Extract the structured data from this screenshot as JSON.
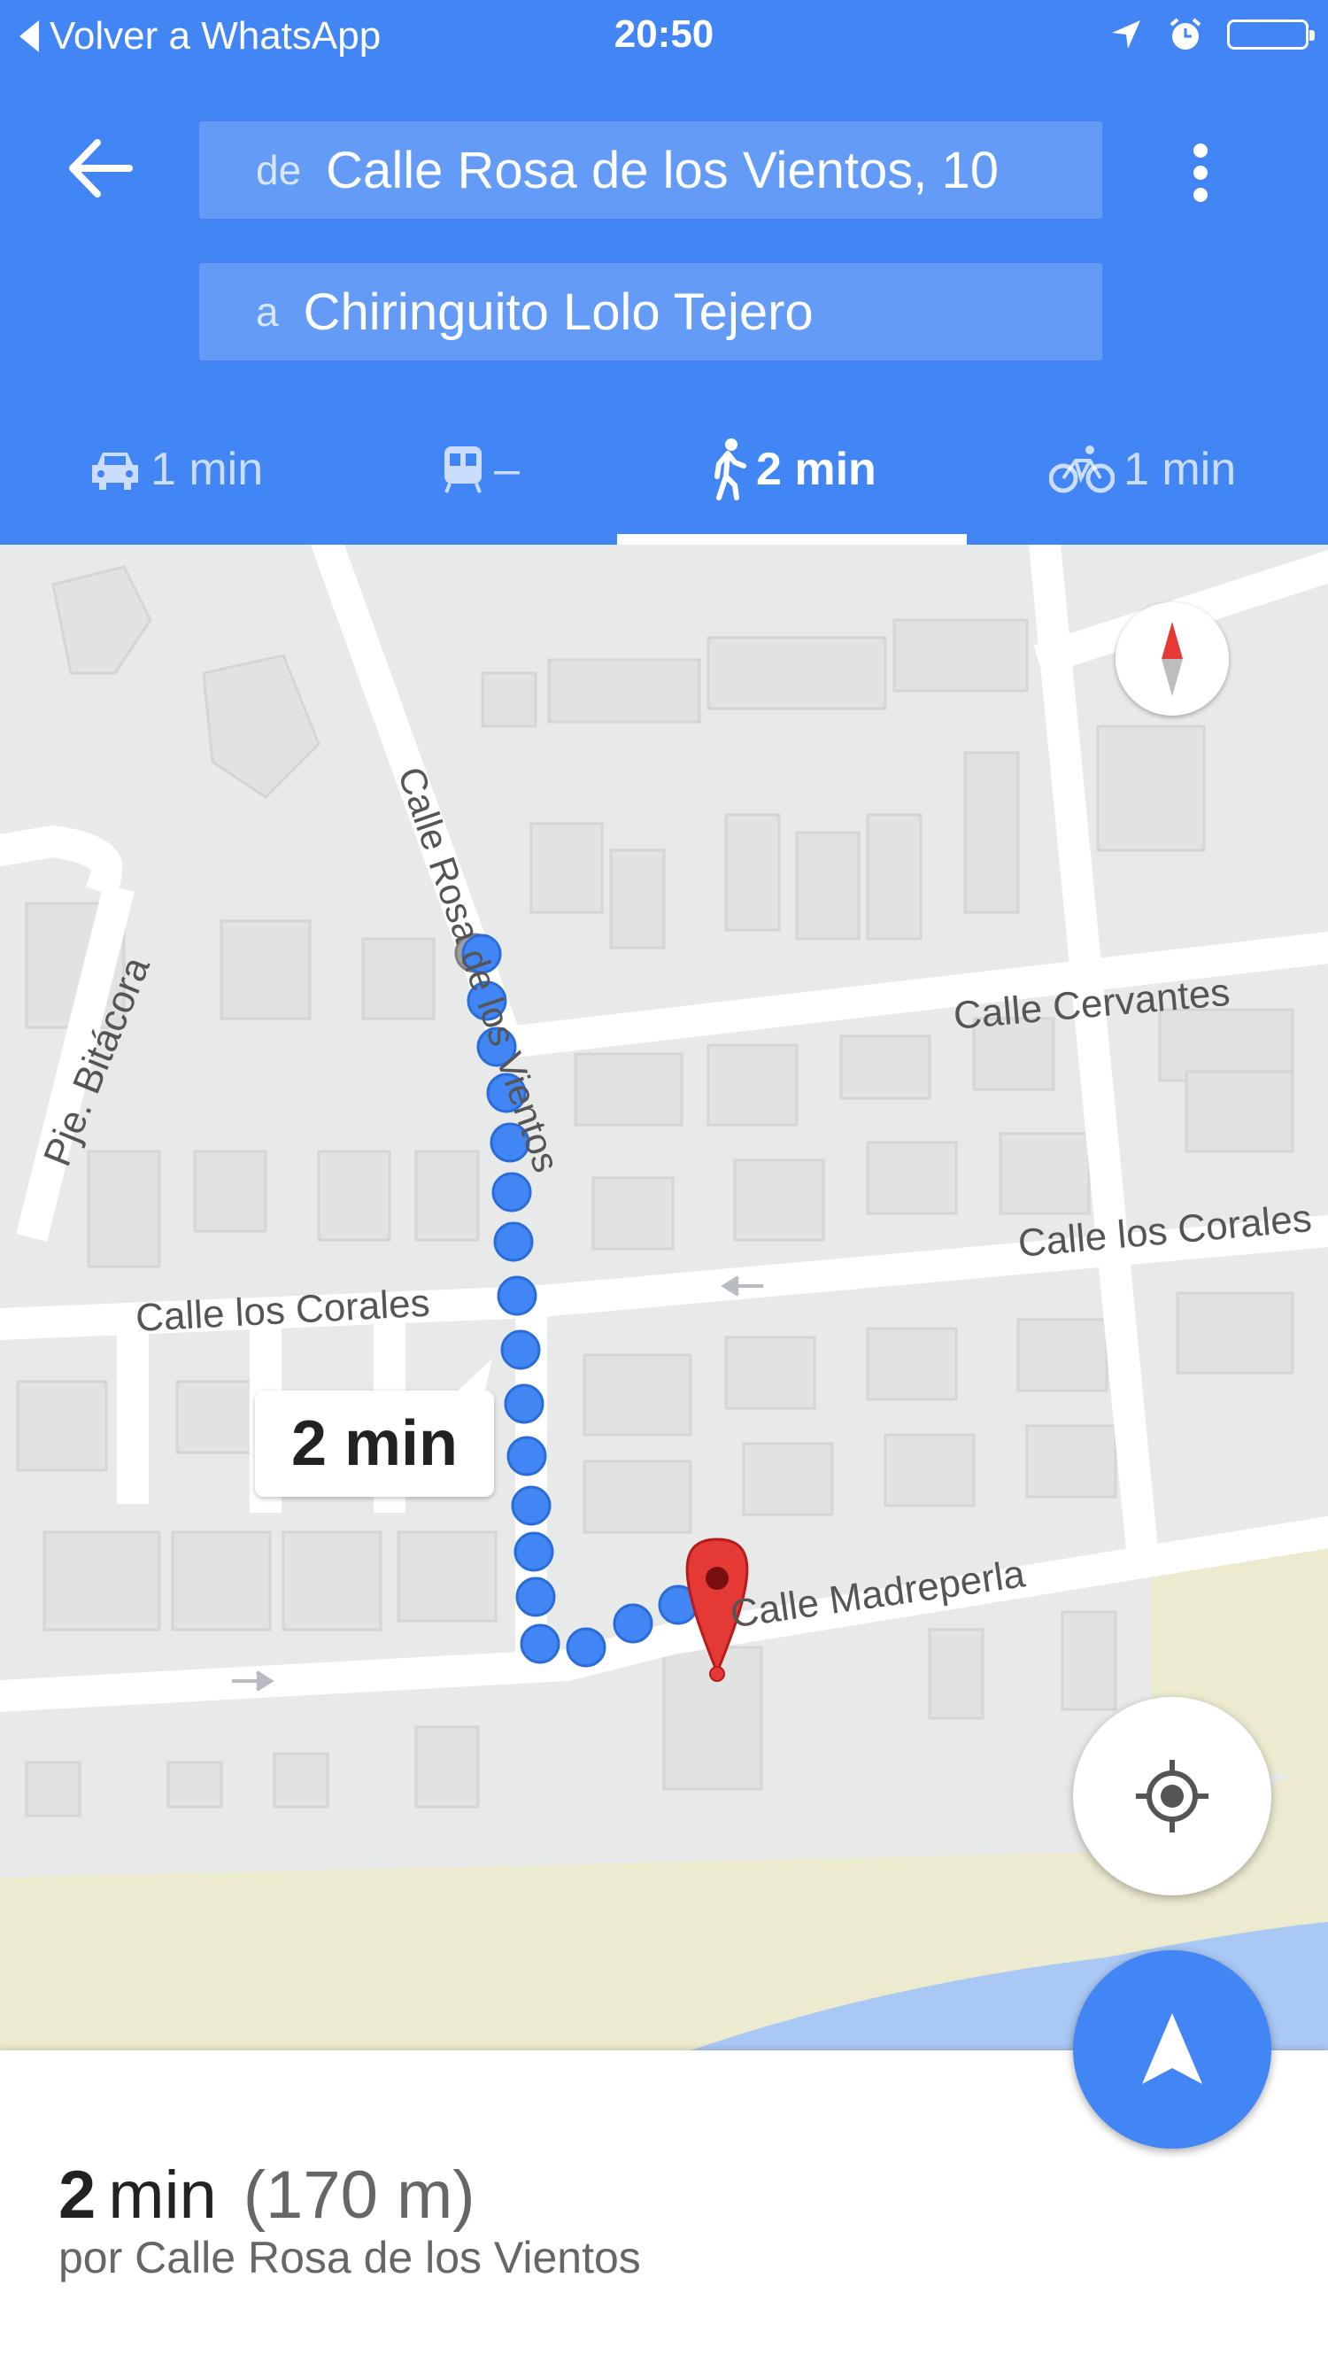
{
  "status_bar": {
    "back_label": "Volver a WhatsApp",
    "time": "20:50",
    "icons": [
      "location-arrow-icon",
      "alarm-icon",
      "battery-icon"
    ]
  },
  "header": {
    "from_prefix": "de",
    "from_value": "Calle Rosa de los Vientos, 10",
    "to_prefix": "a",
    "to_value": "Chiringuito Lolo Tejero",
    "accent_color": "#4285f4"
  },
  "modes": [
    {
      "icon": "car-icon",
      "label": "1 min"
    },
    {
      "icon": "transit-icon",
      "label": "–"
    },
    {
      "icon": "walk-icon",
      "label": "2 min",
      "selected": true
    },
    {
      "icon": "bike-icon",
      "label": "1 min"
    }
  ],
  "map": {
    "streets": {
      "rosa": "Calle Rosa de los Vientos",
      "bitacora": "Pje. Bitácora",
      "cervantes": "Calle Cervantes",
      "corales_left": "Calle los Corales",
      "corales_right": "Calle los Corales",
      "madreperla": "Calle Madreperla"
    },
    "route_time_bubble": "2 min",
    "route_color": "#4285f4",
    "destination_pin_color": "#e53935"
  },
  "summary": {
    "duration_number": "2",
    "duration_unit": "min",
    "distance": "(170 m)",
    "via": "por Calle Rosa de los Vientos"
  }
}
